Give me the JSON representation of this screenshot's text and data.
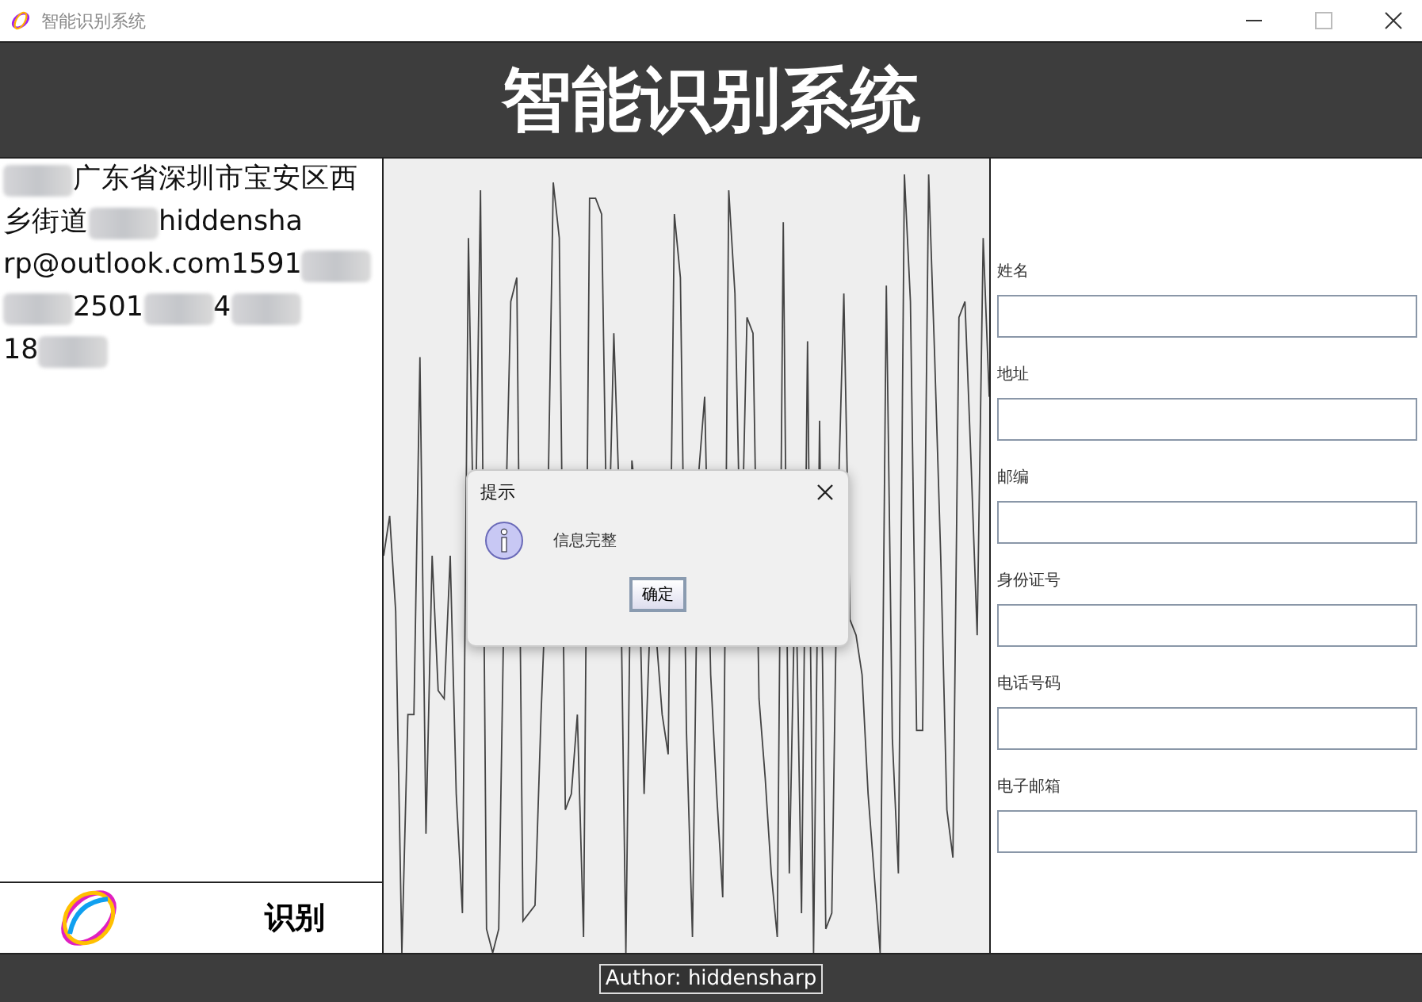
{
  "window": {
    "title": "智能识别系统"
  },
  "header": {
    "title": "智能识别系统"
  },
  "input_panel": {
    "lines": [
      [
        {
          "kind": "redacted"
        },
        {
          "kind": "text",
          "text": "广东省深圳市宝安区西"
        }
      ],
      [
        {
          "kind": "text",
          "text": "乡街道"
        },
        {
          "kind": "redacted"
        },
        {
          "kind": "text",
          "text": "hiddensha"
        }
      ],
      [
        {
          "kind": "text",
          "text": "rp@outlook.com1591"
        },
        {
          "kind": "redacted"
        }
      ],
      [
        {
          "kind": "redacted"
        },
        {
          "kind": "text",
          "text": "2501"
        },
        {
          "kind": "redacted"
        },
        {
          "kind": "text",
          "text": "4"
        },
        {
          "kind": "redacted"
        }
      ],
      [
        {
          "kind": "text",
          "text": "18"
        },
        {
          "kind": "redacted"
        }
      ]
    ]
  },
  "recognize_button": {
    "label": "识别"
  },
  "form": {
    "fields": [
      {
        "label": "姓名"
      },
      {
        "label": "地址"
      },
      {
        "label": "邮编"
      },
      {
        "label": "身份证号"
      },
      {
        "label": "电话号码"
      },
      {
        "label": "电子邮箱"
      }
    ]
  },
  "dialog": {
    "title": "提示",
    "message": "信息完整",
    "button": "确定"
  },
  "footer": {
    "author": "Author: hiddensharp"
  }
}
